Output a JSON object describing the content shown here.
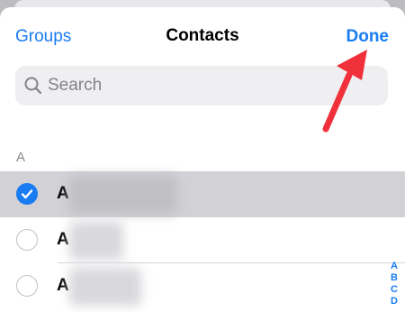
{
  "navbar": {
    "left_label": "Groups",
    "title": "Contacts",
    "right_label": "Done"
  },
  "search": {
    "placeholder": "Search",
    "icon": "search-icon"
  },
  "section": {
    "header": "A"
  },
  "contacts": [
    {
      "initial": "A",
      "selected": true
    },
    {
      "initial": "A",
      "selected": false
    },
    {
      "initial": "A",
      "selected": false
    }
  ],
  "index": [
    "A",
    "B",
    "C",
    "D"
  ],
  "colors": {
    "accent": "#1a7cf2",
    "arrow": "#f0303a",
    "selected_row": "#d1d1d6"
  }
}
